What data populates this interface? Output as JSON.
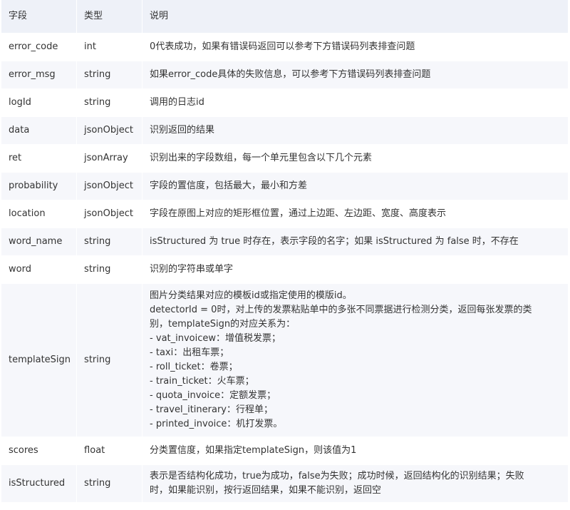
{
  "table": {
    "headers": {
      "field": "字段",
      "type": "类型",
      "desc": "说明"
    },
    "rows": [
      {
        "field": "error_code",
        "type": "int",
        "desc": "0代表成功，如果有错误码返回可以参考下方错误码列表排查问题"
      },
      {
        "field": "error_msg",
        "type": "string",
        "desc": "如果error_code具体的失败信息，可以参考下方错误码列表排查问题"
      },
      {
        "field": "logId",
        "type": "string",
        "desc": "调用的日志id"
      },
      {
        "field": "data",
        "type": "jsonObject",
        "desc": "识别返回的结果"
      },
      {
        "field": "ret",
        "type": "jsonArray",
        "desc": "识别出来的字段数组，每一个单元里包含以下几个元素"
      },
      {
        "field": "probability",
        "type": "jsonObject",
        "desc": "字段的置信度，包括最大，最小和方差"
      },
      {
        "field": "location",
        "type": "jsonObject",
        "desc": "字段在原图上对应的矩形框位置，通过上边距、左边距、宽度、高度表示"
      },
      {
        "field": "word_name",
        "type": "string",
        "desc": "isStructured 为 true 时存在，表示字段的名字；如果 isStructured 为 false 时，不存在"
      },
      {
        "field": "word",
        "type": "string",
        "desc": "识别的字符串或单字"
      },
      {
        "field": "templateSign",
        "type": "string",
        "desc_lines": [
          "图片分类结果对应的模板id或指定使用的模版id。",
          "detectorId = 0时，对上传的发票粘贴单中的多张不同票据进行检测分类，返回每张发票的类",
          "别，templateSign的对应关系为：",
          "- vat_invoicew：增值税发票；",
          "- taxi：出租车票；",
          "- roll_ticket：卷票；",
          "- train_ticket：火车票；",
          "- quota_invoice：定额发票；",
          "- travel_itinerary：行程单；",
          "- printed_invoice：机打发票。"
        ]
      },
      {
        "field": "scores",
        "type": "float",
        "desc": "分类置信度，如果指定templateSign，则该值为1"
      },
      {
        "field": "isStructured",
        "type": "string",
        "desc_lines": [
          "表示是否结构化成功，true为成功，false为失败；成功时候，返回结构化的识别结果；失败",
          "时，如果能识别，按行返回结果，如果不能识别，返回空"
        ]
      }
    ]
  }
}
